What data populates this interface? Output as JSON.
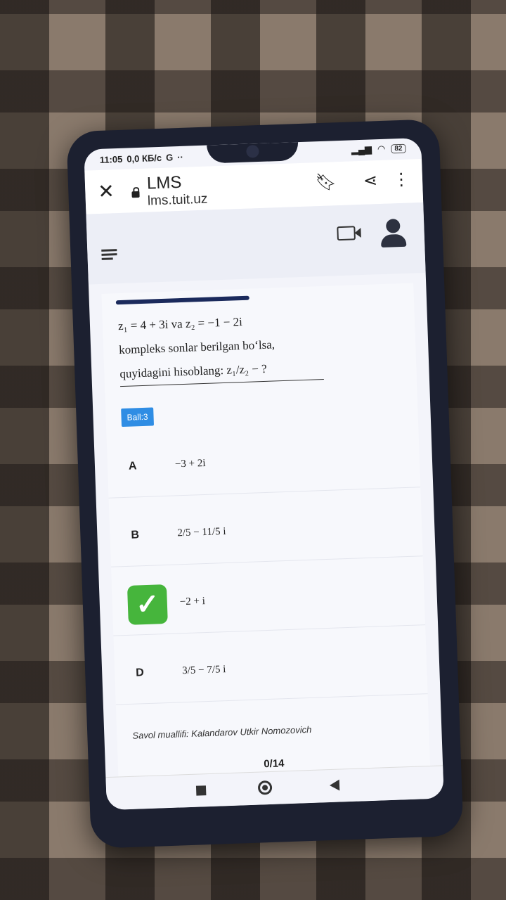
{
  "status": {
    "time": "11:05",
    "data_rate": "0,0 КБ/с",
    "google": "G",
    "more": "··",
    "battery": "82"
  },
  "browser": {
    "title": "LMS",
    "url": "lms.tuit.uz"
  },
  "question": {
    "line1": "z₁ = 4 + 3i    va    z₂ = −1 − 2i",
    "line2": "kompleks sonlar berilgan bo‘lsa,",
    "line3": "quyidagini hisoblang:  z₁/z₂ − ?"
  },
  "ball_label": "Ball:3",
  "options": [
    {
      "letter": "A",
      "value": "−3 + 2i"
    },
    {
      "letter": "B",
      "value": "2/5 − 11/5 i"
    },
    {
      "letter": "",
      "value": "−2 + i"
    },
    {
      "letter": "D",
      "value": "3/5 − 7/5 i"
    }
  ],
  "check_mark": "✓",
  "author": "Savol muallifi: Kalandarov Utkir Nomozovich",
  "counter": "0/14"
}
